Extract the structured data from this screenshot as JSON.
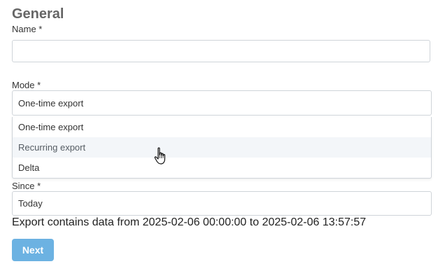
{
  "section": {
    "title": "General"
  },
  "name_field": {
    "label": "Name *",
    "value": ""
  },
  "mode_field": {
    "label": "Mode *",
    "selected": "One-time export",
    "options": [
      "One-time export",
      "Recurring export",
      "Delta"
    ],
    "hovered_option": "Recurring export"
  },
  "since_field": {
    "label": "Since *",
    "selected": "Today"
  },
  "export_info": "Export contains data from 2025-02-06 00:00:00 to 2025-02-06 13:57:57",
  "next_button": {
    "label": "Next",
    "color": "#6cb2e2"
  },
  "cursor_icon": "hand-pointer-icon"
}
